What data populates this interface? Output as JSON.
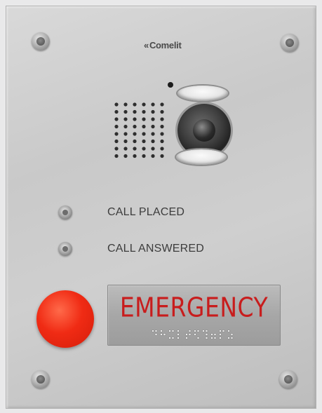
{
  "brand": {
    "name": "Comelit",
    "glyph": "«"
  },
  "labels": {
    "call_placed": "CALL PLACED",
    "call_answered": "CALL ANSWERED"
  },
  "emergency_sign": {
    "text": "EMERGENCY",
    "text_color": "#c81d1d"
  },
  "colors": {
    "button": "#f02b14",
    "panel": "#cfcfcf"
  },
  "icons": [
    "screw-icon",
    "camera-icon",
    "speaker-grill-icon",
    "indicator-led-icon",
    "braille-icon"
  ]
}
